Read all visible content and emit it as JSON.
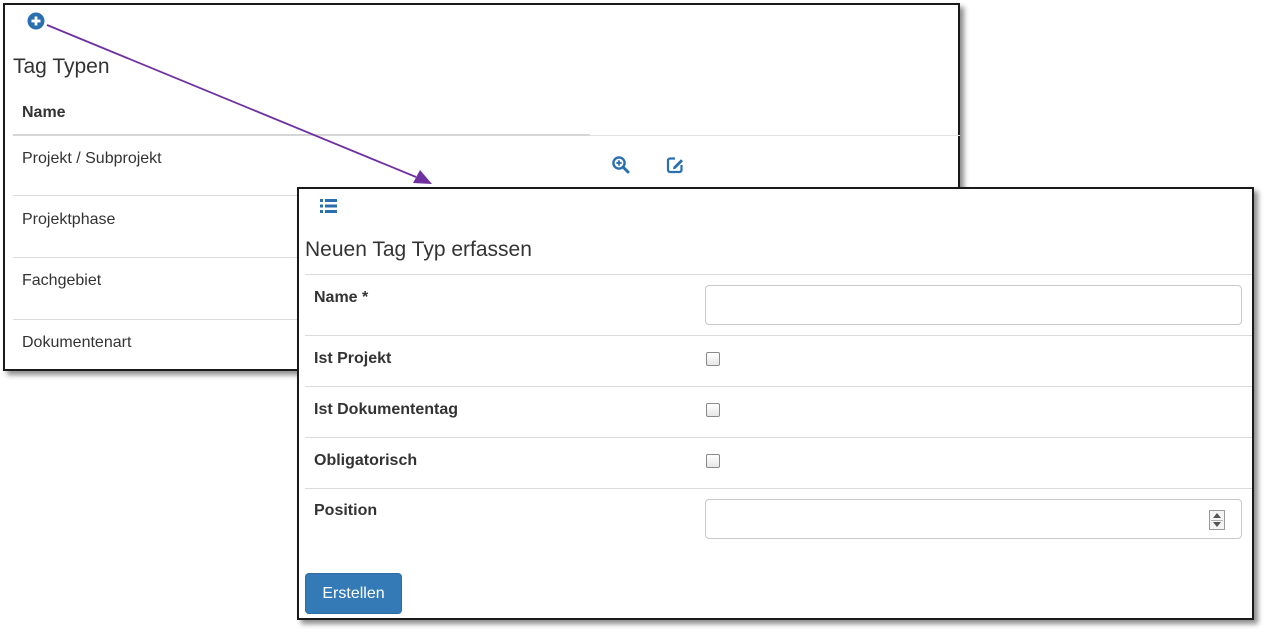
{
  "list": {
    "title": "Tag Typen",
    "column_name": "Name",
    "rows": [
      {
        "name": "Projekt / Subprojekt"
      },
      {
        "name": "Projektphase"
      },
      {
        "name": "Fachgebiet"
      },
      {
        "name": "Dokumentenart"
      }
    ],
    "add_icon": "plus-circle-icon",
    "view_icon": "zoom-in-icon",
    "edit_icon": "edit-icon"
  },
  "form": {
    "title": "Neuen Tag Typ erfassen",
    "list_icon": "list-icon",
    "fields": {
      "name_label": "Name *",
      "name_value": "",
      "ist_projekt_label": "Ist Projekt",
      "ist_projekt_checked": false,
      "ist_dokumententag_label": "Ist Dokumententag",
      "ist_dokumententag_checked": false,
      "obligatorisch_label": "Obligatorisch",
      "obligatorisch_checked": false,
      "position_label": "Position",
      "position_value": ""
    },
    "submit_label": "Erstellen"
  },
  "colors": {
    "accent": "#337ab7",
    "icon": "#2a6fb0",
    "arrow": "#7030a0"
  }
}
